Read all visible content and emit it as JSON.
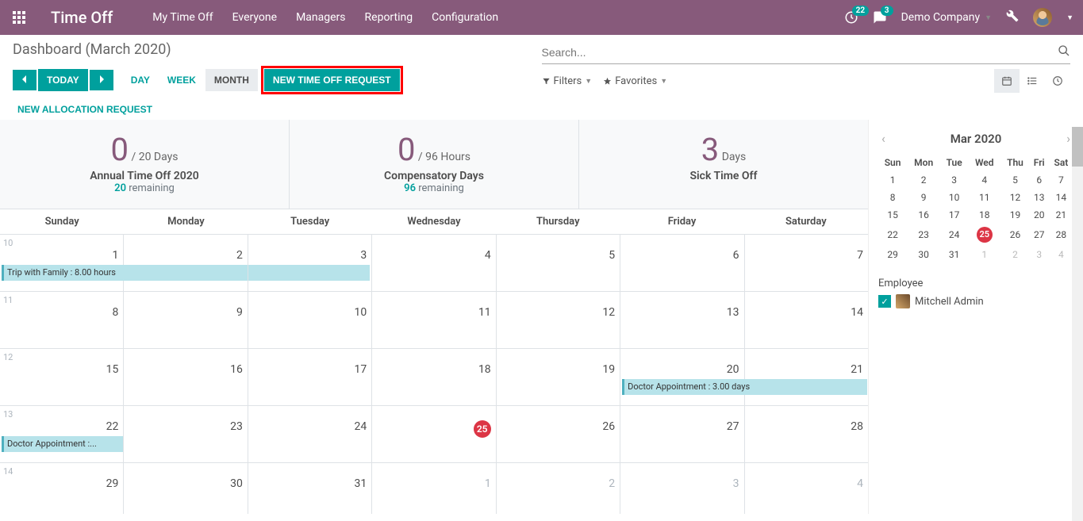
{
  "topbar": {
    "brand": "Time Off",
    "menu": [
      "My Time Off",
      "Everyone",
      "Managers",
      "Reporting",
      "Configuration"
    ],
    "clock_badge": "22",
    "msg_badge": "3",
    "company": "Demo Company"
  },
  "dashboard": {
    "title": "Dashboard (March 2020)",
    "today": "TODAY",
    "day": "DAY",
    "week": "WEEK",
    "month": "MONTH",
    "new_request": "NEW TIME OFF REQUEST",
    "new_allocation": "NEW ALLOCATION REQUEST"
  },
  "search": {
    "placeholder": "Search...",
    "filters": "Filters",
    "favorites": "Favorites"
  },
  "stats": [
    {
      "big": "0",
      "unit": " / 20 Days",
      "title": "Annual Time Off 2020",
      "rem_n": "20",
      "rem_t": " remaining"
    },
    {
      "big": "0",
      "unit": " / 96 Hours",
      "title": "Compensatory Days",
      "rem_n": "96",
      "rem_t": " remaining"
    },
    {
      "big": "3",
      "unit": " Days",
      "title": "Sick Time Off",
      "rem_n": "",
      "rem_t": ""
    }
  ],
  "dow": [
    "Sunday",
    "Monday",
    "Tuesday",
    "Wednesday",
    "Thursday",
    "Friday",
    "Saturday"
  ],
  "weeks": [
    {
      "wk": "10",
      "days": [
        {
          "n": "1"
        },
        {
          "n": "2"
        },
        {
          "n": "3"
        },
        {
          "n": "4"
        },
        {
          "n": "5"
        },
        {
          "n": "6"
        },
        {
          "n": "7"
        }
      ]
    },
    {
      "wk": "11",
      "days": [
        {
          "n": "8"
        },
        {
          "n": "9"
        },
        {
          "n": "10"
        },
        {
          "n": "11"
        },
        {
          "n": "12"
        },
        {
          "n": "13"
        },
        {
          "n": "14"
        }
      ]
    },
    {
      "wk": "12",
      "days": [
        {
          "n": "15"
        },
        {
          "n": "16"
        },
        {
          "n": "17"
        },
        {
          "n": "18"
        },
        {
          "n": "19"
        },
        {
          "n": "20"
        },
        {
          "n": "21"
        }
      ]
    },
    {
      "wk": "13",
      "days": [
        {
          "n": "22"
        },
        {
          "n": "23"
        },
        {
          "n": "24"
        },
        {
          "n": "25",
          "today": true
        },
        {
          "n": "26"
        },
        {
          "n": "27"
        },
        {
          "n": "28"
        }
      ]
    },
    {
      "wk": "14",
      "days": [
        {
          "n": "29"
        },
        {
          "n": "30"
        },
        {
          "n": "31"
        },
        {
          "n": "1",
          "o": true
        },
        {
          "n": "2",
          "o": true
        },
        {
          "n": "3",
          "o": true
        },
        {
          "n": "4",
          "o": true
        }
      ]
    }
  ],
  "events": {
    "trip": "Trip with Family : 8.00 hours",
    "doctor_span": "Doctor Appointment : 3.00 days",
    "doctor_trunc": "Doctor Appointment :..."
  },
  "mini": {
    "title": "Mar 2020",
    "dow": [
      "Sun",
      "Mon",
      "Tue",
      "Wed",
      "Thu",
      "Fri",
      "Sat"
    ],
    "rows": [
      [
        "1",
        "2",
        "3",
        "4",
        "5",
        "6",
        "7"
      ],
      [
        "8",
        "9",
        "10",
        "11",
        "12",
        "13",
        "14"
      ],
      [
        "15",
        "16",
        "17",
        "18",
        "19",
        "20",
        "21"
      ],
      [
        "22",
        "23",
        "24",
        "25",
        "26",
        "27",
        "28"
      ],
      [
        "29",
        "30",
        "31",
        "1",
        "2",
        "3",
        "4"
      ]
    ],
    "today": "25"
  },
  "employee": {
    "label": "Employee",
    "name": "Mitchell Admin"
  }
}
